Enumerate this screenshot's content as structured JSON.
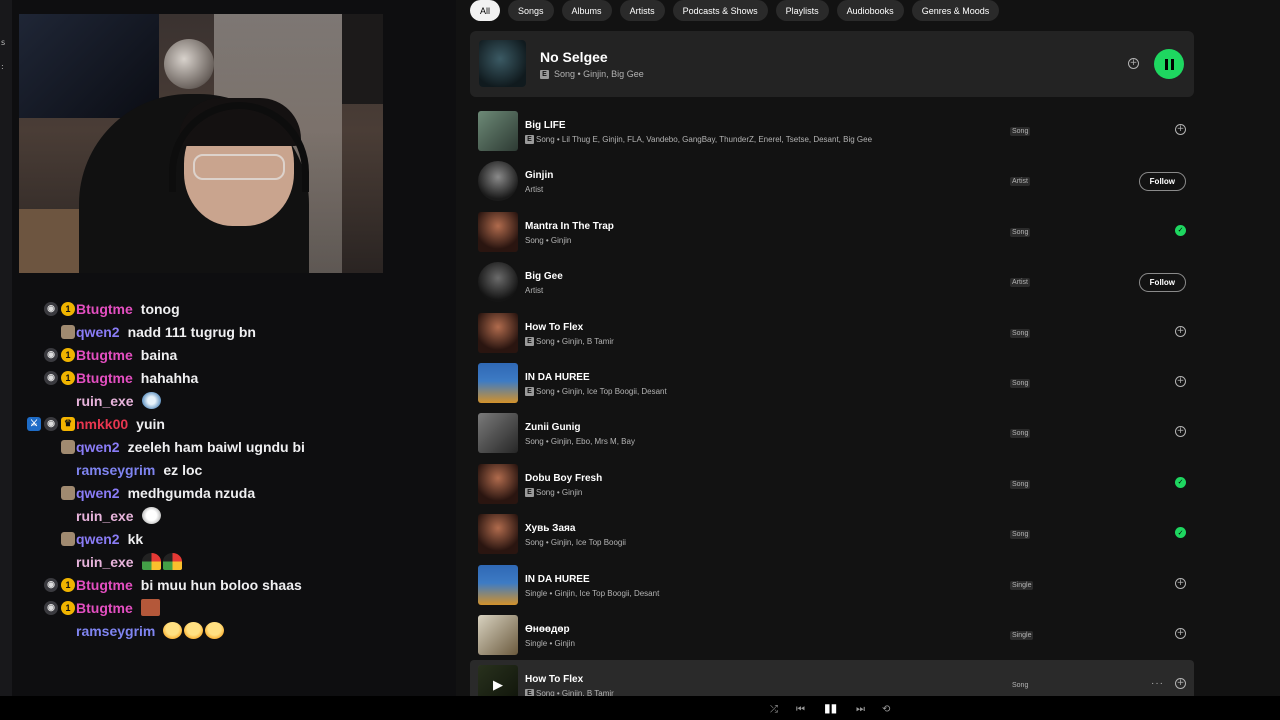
{
  "chat": [
    {
      "badges": [
        "mic",
        "one"
      ],
      "user": "Btugtme",
      "color": "#e44fc1",
      "text": "tonog"
    },
    {
      "badges": [
        "avatar"
      ],
      "user": "qwen2",
      "color": "#8a7cf6",
      "text": "nadd 111 tugrug bn"
    },
    {
      "badges": [
        "mic",
        "one"
      ],
      "user": "Btugtme",
      "color": "#e44fc1",
      "text": "baina"
    },
    {
      "badges": [
        "mic",
        "one"
      ],
      "user": "Btugtme",
      "color": "#e44fc1",
      "text": "hahahha"
    },
    {
      "badges": [],
      "user": "ruin_exe",
      "color": "#e8b4dc",
      "text": "",
      "emotes": [
        "drop"
      ]
    },
    {
      "badges": [
        "sword",
        "mic",
        "crown"
      ],
      "user": "nmkk00",
      "color": "#e8364f",
      "text": "yuin"
    },
    {
      "badges": [
        "avatar"
      ],
      "user": "qwen2",
      "color": "#8a7cf6",
      "text": "zeeleh ham baiwl ugndu bi"
    },
    {
      "badges": [],
      "user": "ramseygrim",
      "color": "#7f84f0",
      "text": "ez loc"
    },
    {
      "badges": [
        "avatar"
      ],
      "user": "qwen2",
      "color": "#8a7cf6",
      "text": "medhgumda nzuda"
    },
    {
      "badges": [],
      "user": "ruin_exe",
      "color": "#e8b4dc",
      "text": "",
      "emotes": [
        "face"
      ]
    },
    {
      "badges": [
        "avatar"
      ],
      "user": "qwen2",
      "color": "#8a7cf6",
      "text": "kk"
    },
    {
      "badges": [],
      "user": "ruin_exe",
      "color": "#e8b4dc",
      "text": "",
      "emotes": [
        "gauge",
        "gauge"
      ]
    },
    {
      "badges": [
        "mic",
        "one"
      ],
      "user": "Btugtme",
      "color": "#e44fc1",
      "text": "bi muu hun boloo shaas"
    },
    {
      "badges": [
        "mic",
        "one"
      ],
      "user": "Btugtme",
      "color": "#e44fc1",
      "text": "",
      "emotes": [
        "block"
      ]
    },
    {
      "badges": [],
      "user": "ramseygrim",
      "color": "#7f84f0",
      "text": "",
      "emotes": [
        "laugh",
        "laugh",
        "laugh"
      ]
    }
  ],
  "left_edge": {
    "mini_1": "s",
    "mini_2": ":"
  },
  "chips": [
    "All",
    "Songs",
    "Albums",
    "Artists",
    "Podcasts & Shows",
    "Playlists",
    "Audiobooks",
    "Genres & Moods"
  ],
  "top_result": {
    "title": "No Selgee",
    "subtitle": "Song • Ginjin, Big Gee",
    "explicit": "E"
  },
  "results": [
    {
      "title": "Big LIFE",
      "sub": "Song • Lil Thug E, Ginjin, FLA, Vandebo, GangBay, ThunderZ, Enerel, Tsetse, Desant, Big Gee",
      "explicit": true,
      "type": "Song",
      "action": "add",
      "thumb": "t-biglife"
    },
    {
      "title": "Ginjin",
      "sub": "Artist",
      "explicit": false,
      "type": "Artist",
      "action": "follow",
      "thumb": "t-ginjin",
      "round": true
    },
    {
      "title": "Mantra In The Trap",
      "sub": "Song • Ginjin",
      "explicit": false,
      "type": "Song",
      "action": "saved",
      "thumb": "t-mantra"
    },
    {
      "title": "Big Gee",
      "sub": "Artist",
      "explicit": false,
      "type": "Artist",
      "action": "follow",
      "thumb": "t-biggee",
      "round": true
    },
    {
      "title": "How To Flex",
      "sub": "Song • Ginjin, B Tamir",
      "explicit": true,
      "type": "Song",
      "action": "add",
      "thumb": "t-mantra"
    },
    {
      "title": "IN DA HUREE",
      "sub": "Song • Ginjin, Ice Top Boogii, Desant",
      "explicit": true,
      "type": "Song",
      "action": "add",
      "thumb": "t-huree"
    },
    {
      "title": "Zunii Gunig",
      "sub": "Song • Ginjin, Ebo, Mrs M, Bay",
      "explicit": false,
      "type": "Song",
      "action": "add",
      "thumb": "t-zunii"
    },
    {
      "title": "Dobu Boy Fresh",
      "sub": "Song • Ginjin",
      "explicit": true,
      "type": "Song",
      "action": "saved",
      "thumb": "t-mantra"
    },
    {
      "title": "Хувь Заяа",
      "sub": "Song • Ginjin, Ice Top Boogii",
      "explicit": false,
      "type": "Song",
      "action": "saved",
      "thumb": "t-mantra"
    },
    {
      "title": "IN DA HUREE",
      "sub": "Single • Ginjin, Ice Top Boogii, Desant",
      "explicit": false,
      "type": "Single",
      "action": "add",
      "thumb": "t-huree"
    },
    {
      "title": "Өнөөдөр",
      "sub": "Single • Ginjin",
      "explicit": false,
      "type": "Single",
      "action": "add",
      "thumb": "t-onoo"
    },
    {
      "title": "How To Flex",
      "sub": "Song • Ginjin, B Tamir",
      "explicit": true,
      "type": "Song",
      "action": "add",
      "thumb": "t-howto2",
      "hover": true
    }
  ],
  "labels": {
    "follow": "Follow",
    "explicit": "E"
  },
  "icons": {
    "add": "plus-circle-icon",
    "saved": "check-circle-icon",
    "pause": "pause-icon",
    "play": "play-icon",
    "more": "more-dots-icon"
  },
  "colors": {
    "spotify_green": "#1ed760",
    "panel_bg": "#121212",
    "chat_bg": "#0e0e10"
  }
}
